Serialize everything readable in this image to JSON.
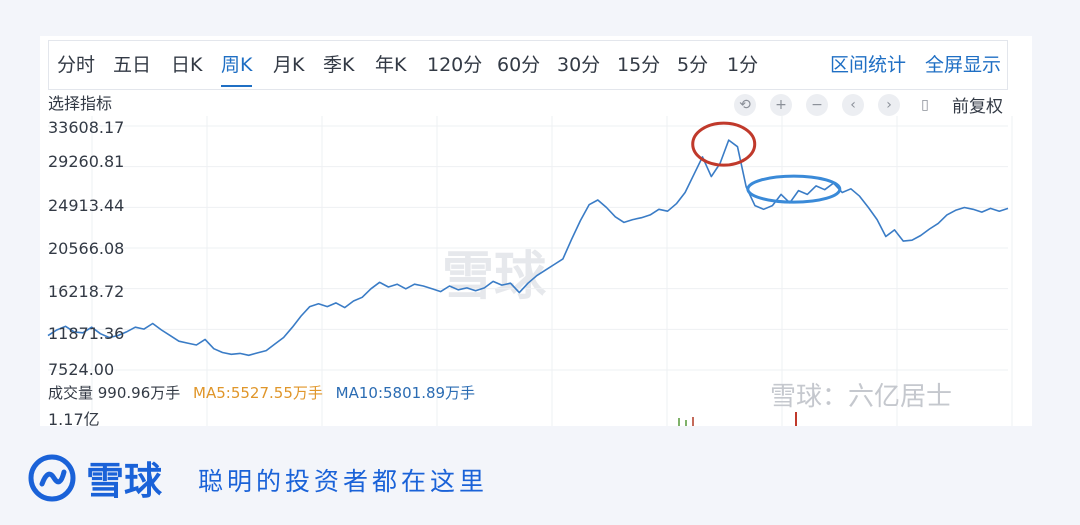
{
  "toolbar": {
    "periods": [
      "分时",
      "五日",
      "日K",
      "周K",
      "月K",
      "季K",
      "年K",
      "120分",
      "60分",
      "30分",
      "15分",
      "5分",
      "1分"
    ],
    "active_period": "周K",
    "range_stats": "区间统计",
    "fullscreen": "全屏显示"
  },
  "indicator": {
    "label": "选择指标"
  },
  "controls": {
    "icons": [
      "reset-icon",
      "zoom-in-icon",
      "zoom-out-icon",
      "scroll-left-icon",
      "scroll-right-icon",
      "settings-icon"
    ],
    "adjust_label": "前复权"
  },
  "colors": {
    "line": "#3a7cc6",
    "active": "#1f6fc4",
    "ma5": "#e0962a",
    "ma10": "#2b6cb3",
    "circle_red": "#c0392b",
    "ellipse_blue": "#3a8ad8",
    "brand": "#1a62d8"
  },
  "volume": {
    "label": "成交量 990.96万手",
    "ma5": "MA5:5527.55万手",
    "ma10": "MA10:5801.89万手",
    "max_label": "1.17亿"
  },
  "watermarks": {
    "center": "雪球",
    "inner": "雪球：六亿居士"
  },
  "footer": {
    "brand": "雪球",
    "slogan": "聪明的投资者都在这里"
  },
  "chart_data": {
    "type": "line",
    "y_ticks": [
      "33608.17",
      "29260.81",
      "24913.44",
      "20566.08",
      "16218.72",
      "11871.36",
      "7524.00"
    ],
    "ylim": [
      7524.0,
      33608.17
    ],
    "values": [
      11200,
      11800,
      12200,
      11600,
      11500,
      12100,
      11400,
      11000,
      11200,
      11600,
      12100,
      11900,
      12500,
      11800,
      11200,
      10600,
      10400,
      10200,
      10800,
      9800,
      9400,
      9200,
      9300,
      9100,
      9350,
      9600,
      10300,
      11000,
      12100,
      13300,
      14300,
      14600,
      14300,
      14700,
      14200,
      14900,
      15300,
      16200,
      16900,
      16400,
      16700,
      16200,
      16700,
      16500,
      16200,
      15900,
      16500,
      16100,
      16300,
      16000,
      16300,
      17000,
      16600,
      16800,
      15800,
      16800,
      17600,
      18200,
      18800,
      19400,
      21500,
      23500,
      25200,
      25700,
      24900,
      23900,
      23300,
      23600,
      23800,
      24100,
      24700,
      24500,
      25300,
      26500,
      28400,
      30300,
      28200,
      29600,
      32100,
      31400,
      27100,
      25100,
      24700,
      25100,
      26300,
      25400,
      26700,
      26300,
      27200,
      26800,
      27500,
      26500,
      26900,
      26100,
      24900,
      23600,
      21800,
      22500,
      21300,
      21400,
      21900,
      22600,
      23200,
      24100,
      24600,
      24900,
      24700,
      24400,
      24800,
      24500,
      24800
    ]
  },
  "annotations": [
    "red-circle-peak",
    "blue-ellipse-plateau"
  ]
}
